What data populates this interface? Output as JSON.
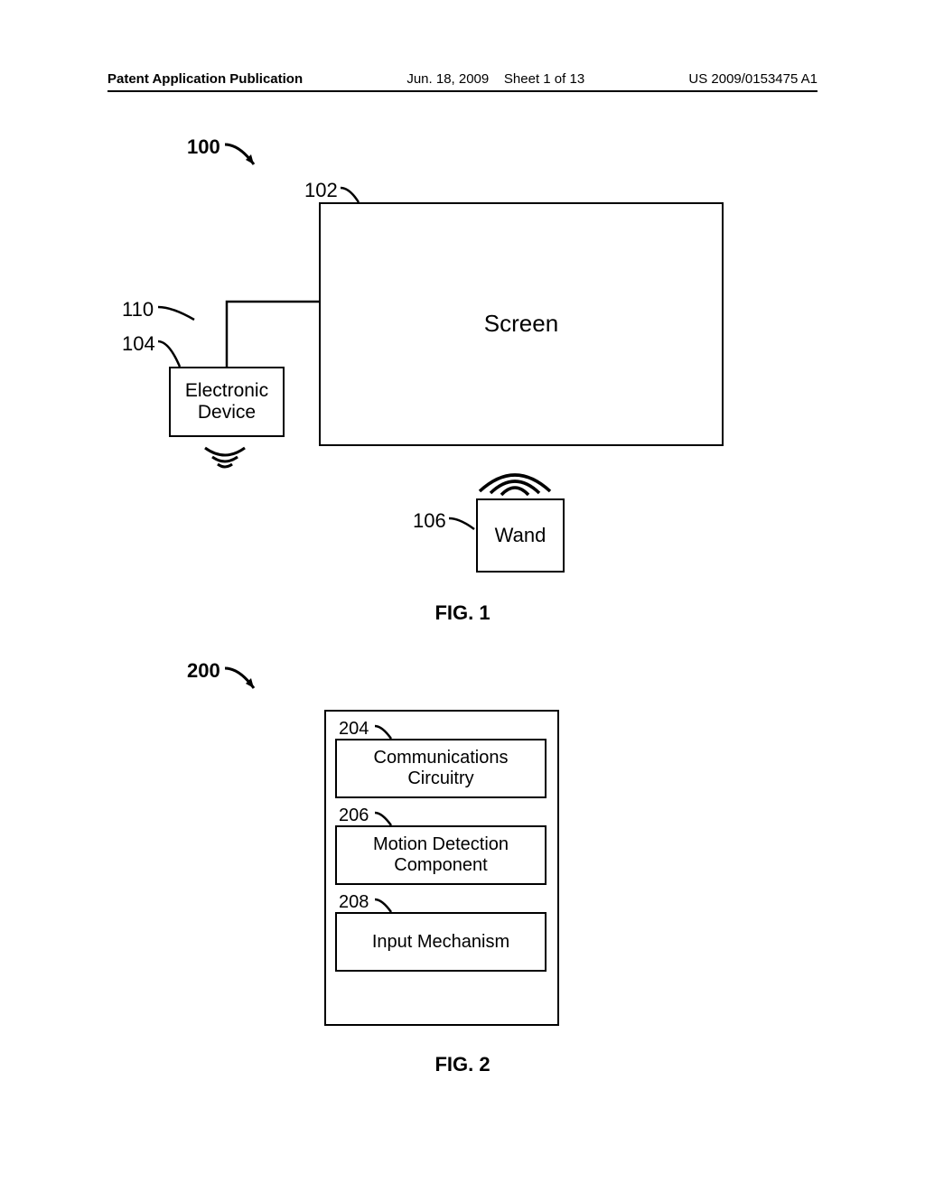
{
  "header": {
    "left": "Patent Application Publication",
    "date": "Jun. 18, 2009",
    "sheet": "Sheet 1 of 13",
    "pubno": "US 2009/0153475 A1"
  },
  "fig1": {
    "ref100": "100",
    "ref102": "102",
    "ref110": "110",
    "ref104": "104",
    "ref106": "106",
    "screen": "Screen",
    "device": "Electronic\nDevice",
    "wand": "Wand",
    "caption": "FIG. 1"
  },
  "fig2": {
    "ref200": "200",
    "ref204": "204",
    "ref206": "206",
    "ref208": "208",
    "comm": "Communications\nCircuitry",
    "motion": "Motion Detection\nComponent",
    "input": "Input Mechanism",
    "caption": "FIG. 2"
  }
}
